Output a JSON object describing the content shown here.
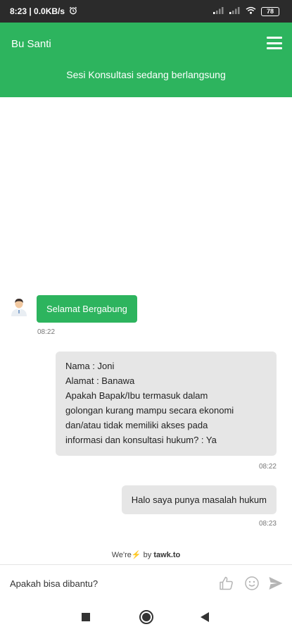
{
  "status_bar": {
    "time_speed": "8:23 | 0.0KB/s",
    "battery": "78"
  },
  "header": {
    "agent_name": "Bu Santi",
    "session_status": "Sesi Konsultasi sedang berlangsung"
  },
  "messages": {
    "agent_welcome": {
      "text": "Selamat Bergabung",
      "time": "08:22"
    },
    "visitor_form": {
      "lines": [
        "Nama : Joni",
        "Alamat : Banawa",
        "Apakah Bapak/Ibu termasuk dalam",
        "golongan kurang mampu secara ekonomi",
        "dan/atau tidak memiliki akses pada",
        "informasi dan konsultasi hukum? : Ya"
      ],
      "time": "08:22"
    },
    "visitor_question": {
      "text": "Halo saya punya masalah hukum",
      "time": "08:23"
    }
  },
  "branding": {
    "prefix": "We're",
    "middle": "by",
    "brand": "tawk.to"
  },
  "composer": {
    "placeholder": "Apakah bisa dibantu?"
  },
  "colors": {
    "brand_green": "#2db45e",
    "bubble_grey": "#e6e6e6",
    "bolt_yellow": "#f5c518"
  },
  "icons": [
    "alarm-icon",
    "signal-icon",
    "wifi-icon",
    "battery-icon",
    "menu-icon",
    "avatar-icon",
    "lightning-icon",
    "thumbs-up-icon",
    "emoji-icon",
    "send-icon"
  ]
}
